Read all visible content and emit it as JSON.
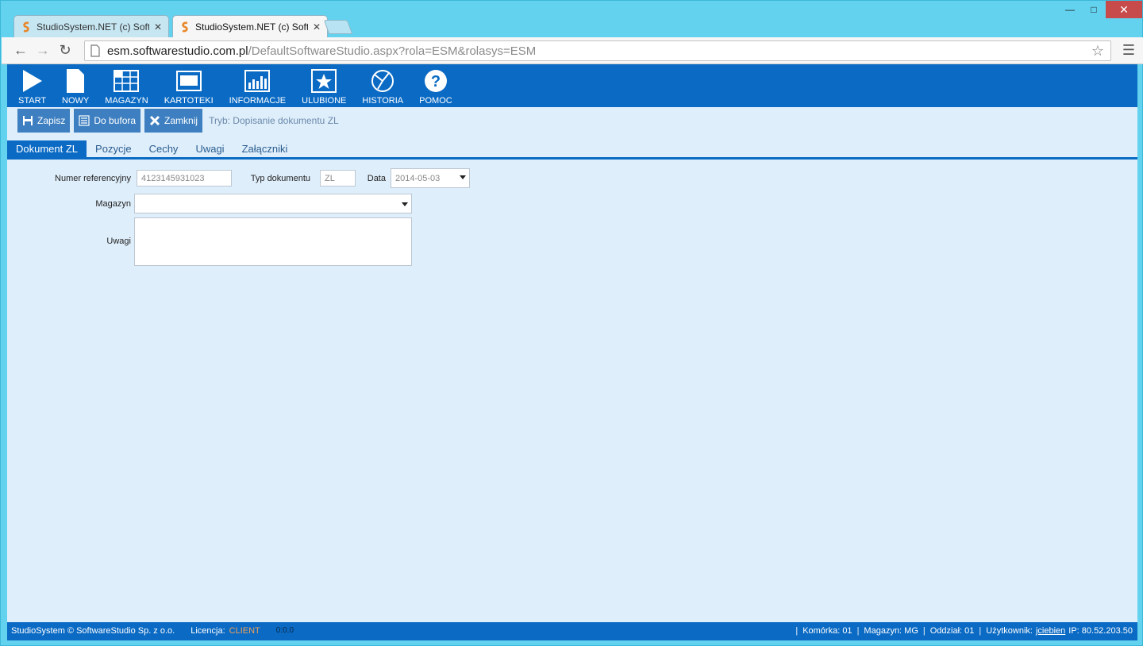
{
  "browser": {
    "tabs": [
      {
        "title": "StudioSystem.NET (c) Soft",
        "active": false
      },
      {
        "title": "StudioSystem.NET (c) Soft",
        "active": true
      }
    ],
    "url_host": "esm.softwarestudio.com.pl",
    "url_path": "/DefaultSoftwareStudio.aspx?rola=ESM&rolasys=ESM"
  },
  "ribbon": {
    "items": [
      {
        "label": "START",
        "icon": "play-icon"
      },
      {
        "label": "NOWY",
        "icon": "document-icon"
      },
      {
        "label": "MAGAZYN",
        "icon": "grid-icon"
      },
      {
        "label": "KARTOTEKI",
        "icon": "window-icon"
      },
      {
        "label": "INFORMACJE",
        "icon": "bar-chart-icon"
      },
      {
        "label": "ULUBIONE",
        "icon": "star-icon"
      },
      {
        "label": "HISTORIA",
        "icon": "history-icon"
      },
      {
        "label": "POMOC",
        "icon": "help-icon"
      }
    ]
  },
  "actions": {
    "save": "Zapisz",
    "buffer": "Do bufora",
    "close": "Zamknij",
    "mode": "Tryb: Dopisanie dokumentu ZL"
  },
  "tabs": [
    "Dokument ZL",
    "Pozycje",
    "Cechy",
    "Uwagi",
    "Załączniki"
  ],
  "form": {
    "ref_label": "Numer referencyjny",
    "ref_value": "4123145931023",
    "type_label": "Typ dokumentu",
    "type_value": "ZL",
    "date_label": "Data",
    "date_value": "2014-05-03",
    "warehouse_label": "Magazyn",
    "warehouse_value": "",
    "notes_label": "Uwagi",
    "notes_value": ""
  },
  "status": {
    "copyright": "StudioSystem © SoftwareStudio Sp. z o.o.",
    "license_label": "Licencja:",
    "license_value": "CLIENT",
    "timer": "0:0.0",
    "cell": "Komórka: 01",
    "warehouse": "Magazyn: MG",
    "branch": "Oddział: 01",
    "user_label": "Użytkownik:",
    "user": "jciebien",
    "ip": "IP: 80.52.203.50"
  },
  "colors": {
    "ribbon": "#0a6ac4",
    "background": "#dfeefb",
    "accent_orange": "#f1a15a"
  }
}
